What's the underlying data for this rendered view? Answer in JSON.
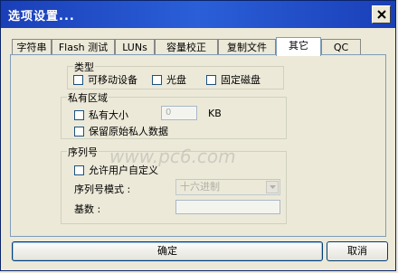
{
  "window": {
    "title": "选项设置..."
  },
  "tabs": [
    "字符串",
    "Flash 测试",
    "LUNs",
    "容量校正",
    "复制文件",
    "其它",
    "QC"
  ],
  "type_group": {
    "title": "类型",
    "options": [
      "可移动设备",
      "光盘",
      "固定磁盘"
    ]
  },
  "private_group": {
    "title": "私有区域",
    "size_label": "私有大小",
    "size_value": "0",
    "size_unit": "KB",
    "keep_label": "保留原始私人数据"
  },
  "serial_group": {
    "title": "序列号",
    "custom_label": "允许用户自定义",
    "mode_label": "序列号模式 :",
    "mode_value": "十六进制",
    "base_label": "基数 :",
    "base_value": ""
  },
  "buttons": {
    "ok": "确定",
    "cancel": "取消"
  },
  "watermark": {
    "text": "www.pc6.com"
  }
}
